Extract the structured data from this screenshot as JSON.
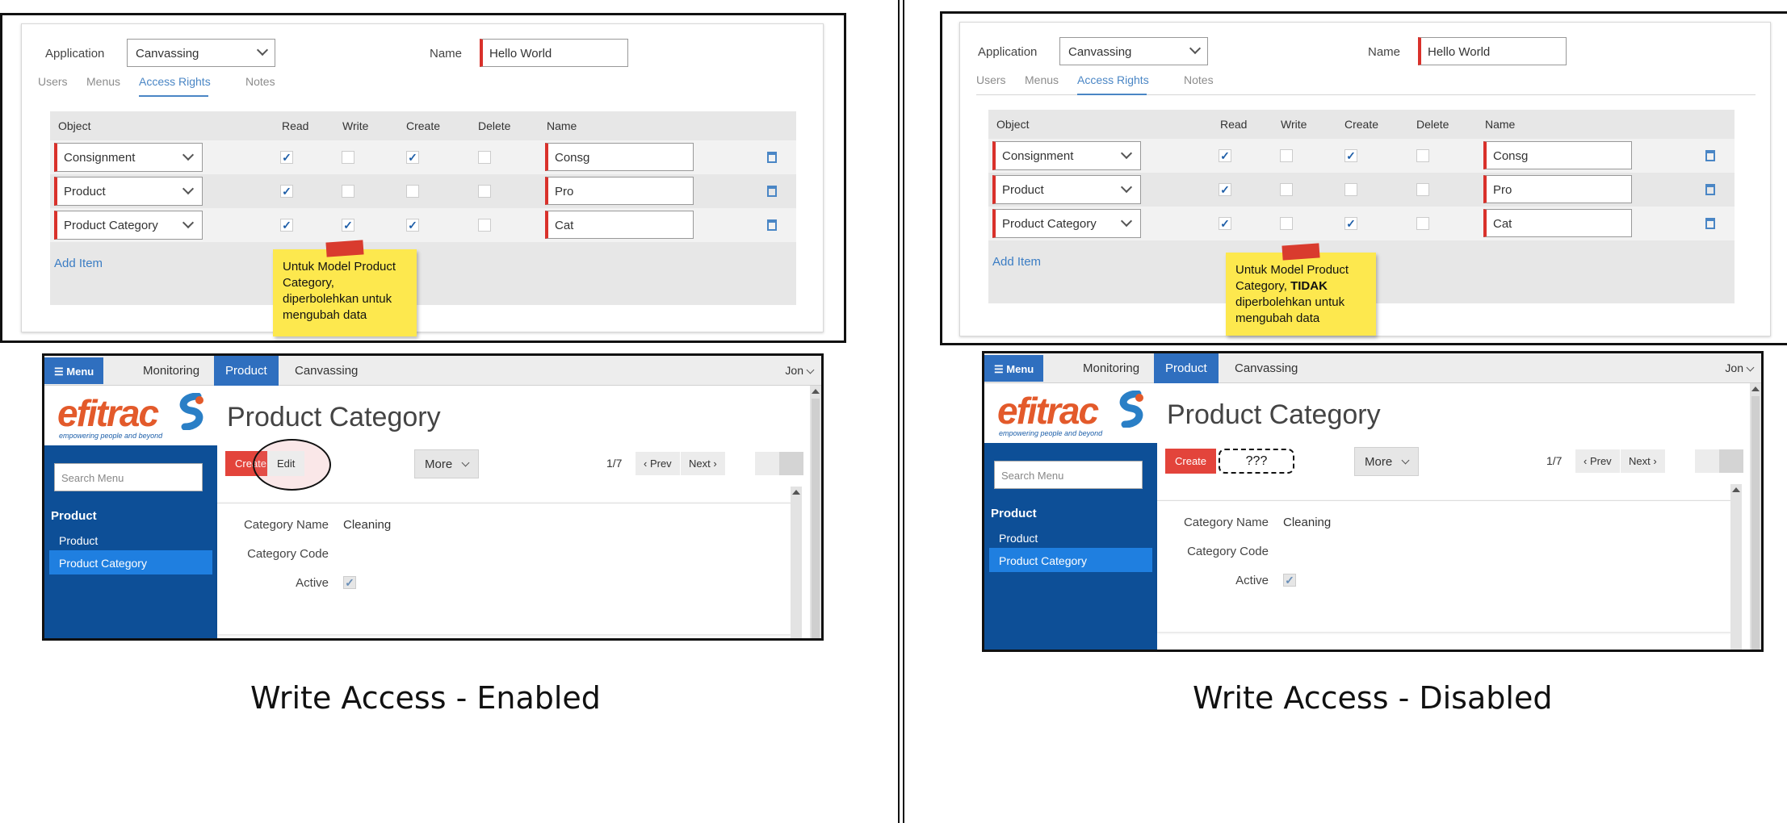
{
  "panels": [
    {
      "settings": {
        "application_label": "Application",
        "application_value": "Canvassing",
        "name_label": "Name",
        "name_value": "Hello World",
        "tabs": [
          "Users",
          "Menus",
          "Access Rights",
          "Notes"
        ],
        "active_tab": "Access Rights"
      },
      "grid": {
        "headers": [
          "Object",
          "Read",
          "Write",
          "Create",
          "Delete",
          "Name"
        ],
        "rows": [
          {
            "object": "Consignment",
            "read": true,
            "write": false,
            "create": true,
            "delete": false,
            "name": "Consg"
          },
          {
            "object": "Product",
            "read": true,
            "write": false,
            "create": false,
            "delete": false,
            "name": "Pro"
          },
          {
            "object": "Product Category",
            "read": true,
            "write": true,
            "create": true,
            "delete": false,
            "name": "Cat"
          }
        ],
        "add_item": "Add Item"
      },
      "note": {
        "line1": "Untuk Model Product",
        "line2": "Category,",
        "line3": "diperbolehkan untuk",
        "line4": "mengubah data"
      },
      "odoo": {
        "menu": "Menu",
        "nav": [
          "Monitoring",
          "Product",
          "Canvassing"
        ],
        "active_nav": "Product",
        "user": "Jon",
        "logo_word": "efitrac",
        "logo_sub": "empowering people and beyond",
        "search_placeholder": "Search Menu",
        "sidebar_heading": "Product",
        "sidebar_items": [
          "Product",
          "Product Category"
        ],
        "active_item": "Product Category",
        "title": "Product Category",
        "create": "Create",
        "edit": "Edit",
        "more": "More",
        "pager": "1/7",
        "prev": "Prev",
        "next": "Next",
        "fields": [
          {
            "label": "Category Name",
            "value": "Cleaning"
          },
          {
            "label": "Category Code",
            "value": ""
          },
          {
            "label": "Active",
            "value": "checked"
          }
        ]
      },
      "caption": "Write Access - Enabled"
    },
    {
      "settings": {
        "application_label": "Application",
        "application_value": "Canvassing",
        "name_label": "Name",
        "name_value": "Hello World",
        "tabs": [
          "Users",
          "Menus",
          "Access Rights",
          "Notes"
        ],
        "active_tab": "Access Rights"
      },
      "grid": {
        "headers": [
          "Object",
          "Read",
          "Write",
          "Create",
          "Delete",
          "Name"
        ],
        "rows": [
          {
            "object": "Consignment",
            "read": true,
            "write": false,
            "create": true,
            "delete": false,
            "name": "Consg"
          },
          {
            "object": "Product",
            "read": true,
            "write": false,
            "create": false,
            "delete": false,
            "name": "Pro"
          },
          {
            "object": "Product Category",
            "read": true,
            "write": false,
            "create": true,
            "delete": false,
            "name": "Cat"
          }
        ],
        "add_item": "Add Item"
      },
      "note": {
        "line1": "Untuk Model Product",
        "line2_prefix": "Category, ",
        "line2_bold": "TIDAK",
        "line3": "diperbolehkan untuk",
        "line4": "mengubah data"
      },
      "odoo": {
        "menu": "Menu",
        "nav": [
          "Monitoring",
          "Product",
          "Canvassing"
        ],
        "active_nav": "Product",
        "user": "Jon",
        "logo_word": "efitrac",
        "logo_sub": "empowering people and beyond",
        "search_placeholder": "Search Menu",
        "sidebar_heading": "Product",
        "sidebar_items": [
          "Product",
          "Product Category"
        ],
        "active_item": "Product Category",
        "title": "Product Category",
        "create": "Create",
        "placeholder": "???",
        "more": "More",
        "pager": "1/7",
        "prev": "Prev",
        "next": "Next",
        "fields": [
          {
            "label": "Category Name",
            "value": "Cleaning"
          },
          {
            "label": "Category Code",
            "value": ""
          },
          {
            "label": "Active",
            "value": "checked"
          }
        ]
      },
      "caption": "Write Access - Disabled"
    }
  ],
  "colors": {
    "accent": "#2f6fbf",
    "sidebar": "#0d4f97",
    "required": "#d9312b",
    "create": "#e3443b",
    "note": "#fde84e",
    "link": "#3b7dc4"
  },
  "icons": {
    "delete": "trash-icon",
    "check": "check-icon",
    "menu": "hamburger-icon"
  }
}
